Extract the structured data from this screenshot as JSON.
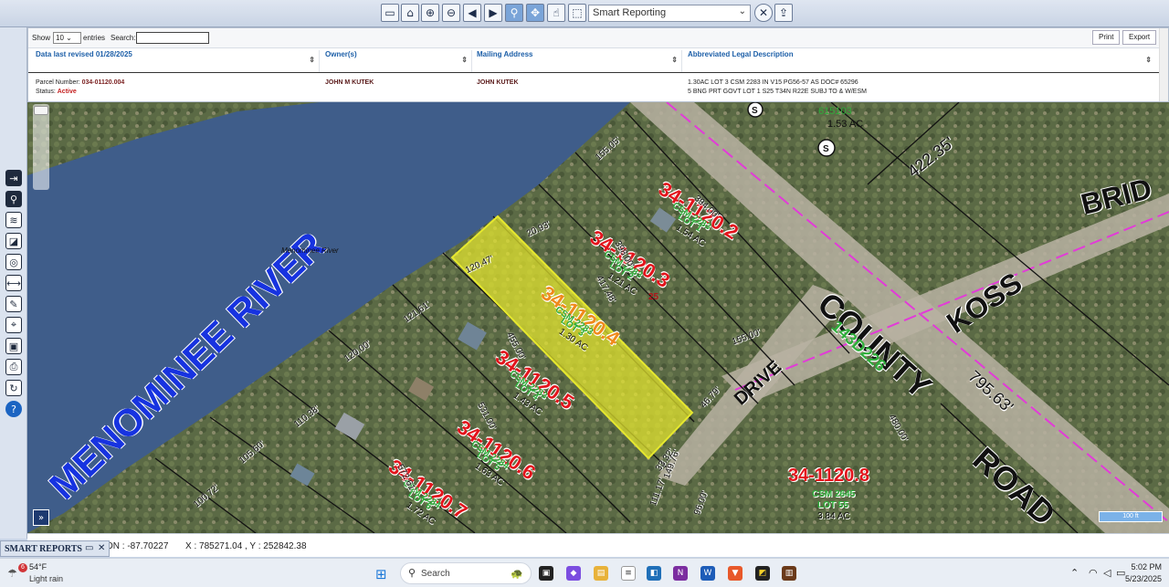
{
  "toolbar": {
    "reporting_selected": "Smart Reporting"
  },
  "report": {
    "show_label": "Show",
    "show_value": "10",
    "entries_label": "entries",
    "search_label": "Search:",
    "print_label": "Print",
    "export_label": "Export",
    "columns": [
      "Data last revised 01/28/2025",
      "Owner(s)",
      "Mailing Address",
      "Abbreviated Legal Description"
    ],
    "row": {
      "parcel_label": "Parcel Number:",
      "parcel_number": "034-01120.004",
      "status_label": "Status:",
      "status_value": "Active",
      "owner": "JOHN M KUTEK",
      "mailing": "JOHN KUTEK",
      "legal_line1": "1.30AC LOT 3 CSM 2283 IN V15 PG56-57 AS DOC# 65296",
      "legal_line2": "5 BNG PRT GOVT LOT 1 S25 T34N R22E SUBJ TO & W/ESM"
    }
  },
  "map": {
    "river_label": "MENOMINEE RIVER",
    "river_small_label": "Menominee River",
    "road_county": "COUNTY",
    "road_road": "ROAD",
    "road_koss": "KOSS",
    "road_drive": "DRIVE",
    "road_brid": "BRID",
    "scale_label": "100 ft",
    "dims": [
      "155.05'",
      "394.00'",
      "422.35'",
      "20.93'",
      "120.47'",
      "398.00'",
      "417.48'",
      "121.61'",
      "120.00'",
      "110.38'",
      "105.60'",
      "100.72'",
      "572.61'",
      "531.00'",
      "455.00'",
      "155.00'",
      "46.79'",
      "795.63'",
      "480.00'",
      "149.76'",
      "111.17'",
      "33.32'",
      "96.00'"
    ],
    "parcels": [
      {
        "id": "34-1120.2",
        "csm": "CSM 2283",
        "lot": "LOT 1",
        "acres": "1.54 AC"
      },
      {
        "id": "34-1120.3",
        "csm": "CSM 2283",
        "lot": "LOT 2",
        "acres": "1.21 AC"
      },
      {
        "id": "34-1120.4",
        "csm": "CSM 2283",
        "lot": "LOT 3",
        "acres": "1.30 AC"
      },
      {
        "id": "34-1120.5",
        "csm": "CSM 2283",
        "lot": "LOT 4",
        "acres": "1.43 AC"
      },
      {
        "id": "34-1120.6",
        "csm": "CSM 2284",
        "lot": "LOT 5",
        "acres": "1.63 AC"
      },
      {
        "id": "34-1120.7",
        "csm": "CSM 2284",
        "lot": "LOT 6",
        "acres": "1.72 AC"
      },
      {
        "id": "34-1120.8",
        "csm": "CSM 2645",
        "lot": "LOT 55",
        "acres": "3.84 AC"
      }
    ],
    "upper_parcel": {
      "doc": "615103",
      "acres": "1.53 AC"
    },
    "green_code": "143D226",
    "small_marker": "25"
  },
  "status": {
    "lon_label": "ON : -87.70227",
    "xy_label": "X : 785271.04 , Y : 252842.38"
  },
  "smart_reports": {
    "label": "SMART REPORTS"
  },
  "taskbar": {
    "weather_temp": "54°F",
    "weather_desc": "Light rain",
    "weather_badge": "6",
    "search_label": "Search",
    "time": "5:02 PM",
    "date": "5/23/2025"
  },
  "colors": {
    "highlight": "#e6e82e",
    "parcel_red": "#e3141c",
    "csm_green": "#2fae3b",
    "river": "#3f5d8a",
    "river_label": "#1733e0",
    "road_line": "#e23bd8"
  }
}
